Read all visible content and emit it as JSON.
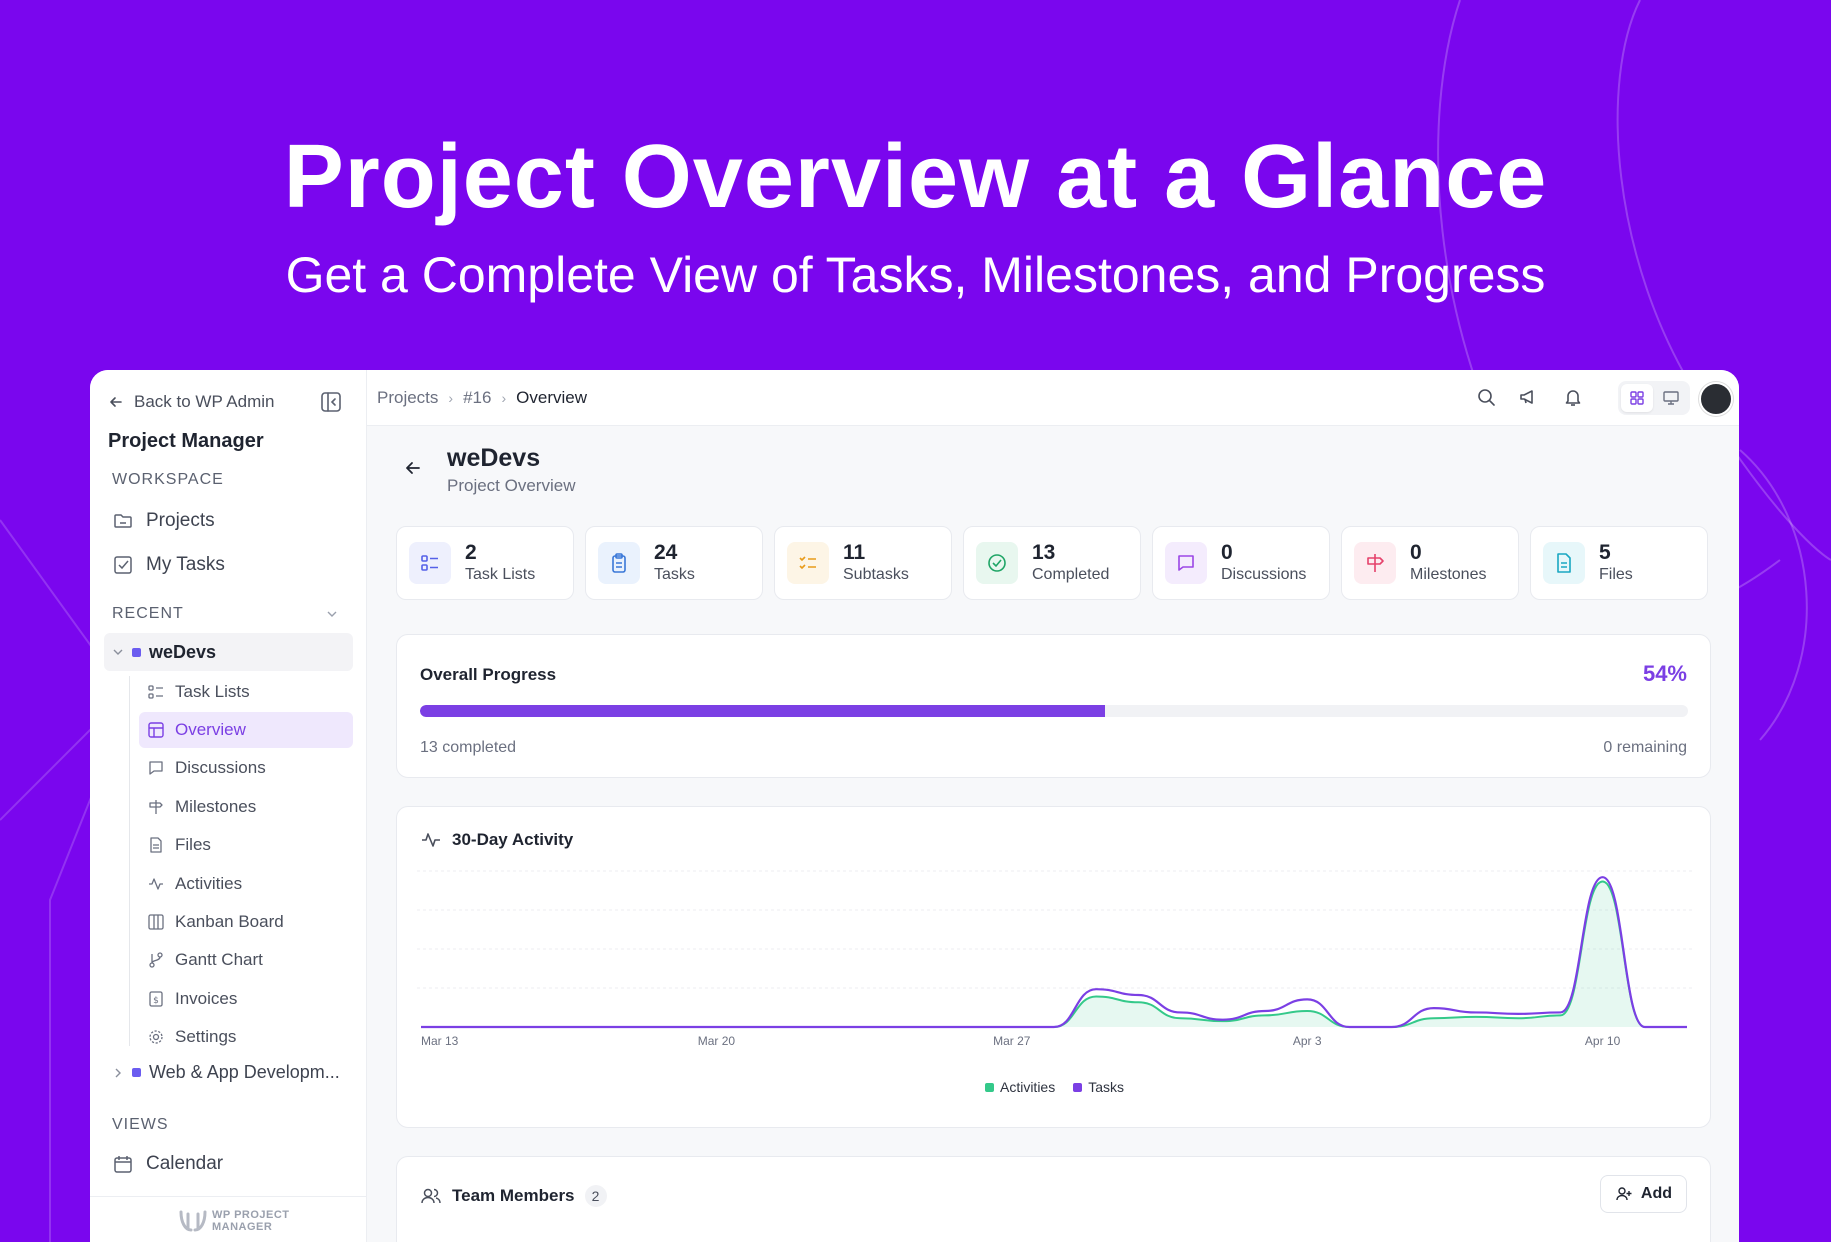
{
  "hero": {
    "title": "Project Overview at a Glance",
    "subtitle": "Get a Complete View of  Tasks, Milestones, and Progress"
  },
  "sidebar": {
    "back_label": "Back to WP Admin",
    "app_title": "Project Manager",
    "workspace_label": "WORKSPACE",
    "workspace_items": [
      {
        "label": "Projects",
        "icon": "folder-icon"
      },
      {
        "label": "My Tasks",
        "icon": "checkbox-icon"
      }
    ],
    "recent_label": "RECENT",
    "project_name": "weDevs",
    "project_items": [
      {
        "label": "Task Lists",
        "icon": "list-icon"
      },
      {
        "label": "Overview",
        "icon": "layout-icon",
        "active": true
      },
      {
        "label": "Discussions",
        "icon": "chat-icon"
      },
      {
        "label": "Milestones",
        "icon": "signpost-icon"
      },
      {
        "label": "Files",
        "icon": "file-icon"
      },
      {
        "label": "Activities",
        "icon": "activity-icon"
      },
      {
        "label": "Kanban Board",
        "icon": "kanban-icon"
      },
      {
        "label": "Gantt Chart",
        "icon": "branch-icon"
      },
      {
        "label": "Invoices",
        "icon": "invoice-icon"
      },
      {
        "label": "Settings",
        "icon": "gear-icon"
      }
    ],
    "other_project": "Web & App Developm...",
    "views_label": "VIEWS",
    "views_items": [
      {
        "label": "Calendar",
        "icon": "calendar-icon"
      }
    ],
    "logo_text_1": "WP PROJECT",
    "logo_text_2": "MANAGER"
  },
  "topbar": {
    "breadcrumb": [
      "Projects",
      "#16",
      "Overview"
    ]
  },
  "page": {
    "title": "weDevs",
    "subtitle": "Project Overview"
  },
  "stats": [
    {
      "value": "2",
      "label": "Task Lists",
      "icon": "list-icon",
      "bg": "#eef0fd",
      "fg": "#5561e8"
    },
    {
      "value": "24",
      "label": "Tasks",
      "icon": "clipboard-icon",
      "bg": "#eaf2fd",
      "fg": "#3a78d8"
    },
    {
      "value": "11",
      "label": "Subtasks",
      "icon": "checklist-icon",
      "bg": "#fdf5e6",
      "fg": "#e89b1a"
    },
    {
      "value": "13",
      "label": "Completed",
      "icon": "check-circle-icon",
      "bg": "#e8f7ef",
      "fg": "#1fa566"
    },
    {
      "value": "0",
      "label": "Discussions",
      "icon": "chat-icon",
      "bg": "#f4ecfd",
      "fg": "#9b46e6"
    },
    {
      "value": "0",
      "label": "Milestones",
      "icon": "signpost-icon",
      "bg": "#fdecf0",
      "fg": "#e5416b"
    },
    {
      "value": "5",
      "label": "Files",
      "icon": "file-icon",
      "bg": "#e7f7fa",
      "fg": "#1aa7c2"
    }
  ],
  "progress": {
    "title": "Overall Progress",
    "percent_label": "54%",
    "percent": 54,
    "completed_label": "13 completed",
    "remaining_label": "0 remaining"
  },
  "activity": {
    "title": "30-Day Activity"
  },
  "chart_data": {
    "type": "area",
    "title": "30-Day Activity",
    "x_tick_labels": [
      "Mar 13",
      "Mar 20",
      "Mar 27",
      "Apr 3",
      "Apr 10"
    ],
    "x": [
      "Mar 13",
      "Mar 14",
      "Mar 15",
      "Mar 16",
      "Mar 17",
      "Mar 18",
      "Mar 19",
      "Mar 20",
      "Mar 21",
      "Mar 22",
      "Mar 23",
      "Mar 24",
      "Mar 25",
      "Mar 26",
      "Mar 27",
      "Mar 28",
      "Mar 29",
      "Mar 30",
      "Mar 31",
      "Apr 1",
      "Apr 2",
      "Apr 3",
      "Apr 4",
      "Apr 5",
      "Apr 6",
      "Apr 7",
      "Apr 8",
      "Apr 9",
      "Apr 10",
      "Apr 11",
      "Apr 12"
    ],
    "series": [
      {
        "name": "Activities",
        "color": "#34c98a",
        "values": [
          0,
          0,
          0,
          0,
          0,
          0,
          0,
          0,
          0,
          0,
          0,
          0,
          0,
          0,
          0,
          0,
          2.1,
          1.7,
          0.6,
          0.4,
          0.8,
          1.1,
          0,
          0,
          0.6,
          0.7,
          0.6,
          0.8,
          10,
          0,
          0
        ]
      },
      {
        "name": "Tasks",
        "color": "#7b3fe4",
        "values": [
          0,
          0,
          0,
          0,
          0,
          0,
          0,
          0,
          0,
          0,
          0,
          0,
          0,
          0,
          0,
          0,
          2.6,
          2.2,
          1.0,
          0.5,
          1.1,
          1.9,
          0,
          0,
          1.3,
          1.0,
          0.9,
          1.0,
          10.3,
          0,
          0
        ]
      }
    ],
    "ylim": [
      0,
      11
    ],
    "grid": true,
    "legend": "bottom-center"
  },
  "team": {
    "title": "Team Members",
    "count": "2",
    "add_label": "Add"
  },
  "colors": {
    "brand_bg": "#7a06ee",
    "accent": "#7b3fe4"
  }
}
